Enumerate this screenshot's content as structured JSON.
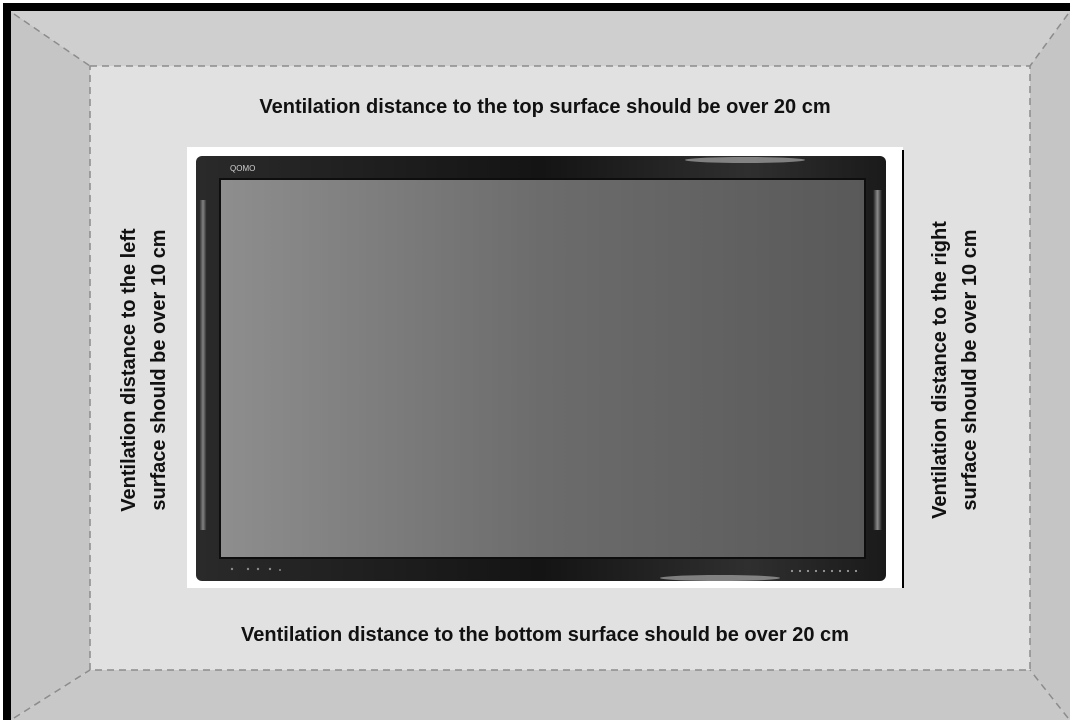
{
  "brand_logo_text": "QOMO",
  "labels": {
    "top": "Ventilation distance to the top surface should be over 20 cm",
    "bottom": "Ventilation distance to the bottom surface should be over 20 cm",
    "left_line1": "Ventilation distance to the left",
    "left_line2": "surface should be over 10 cm",
    "right_line1": "Ventilation distance to the right",
    "right_line2": "surface should be over 10 cm"
  },
  "colors": {
    "frame": "#000000",
    "walls": "#cbcbcb",
    "back_wall": "#e1e1e1",
    "dashed_line": "#8c8c8c",
    "bezel": "#1a1a1a",
    "screen": "#5f5f5f"
  }
}
